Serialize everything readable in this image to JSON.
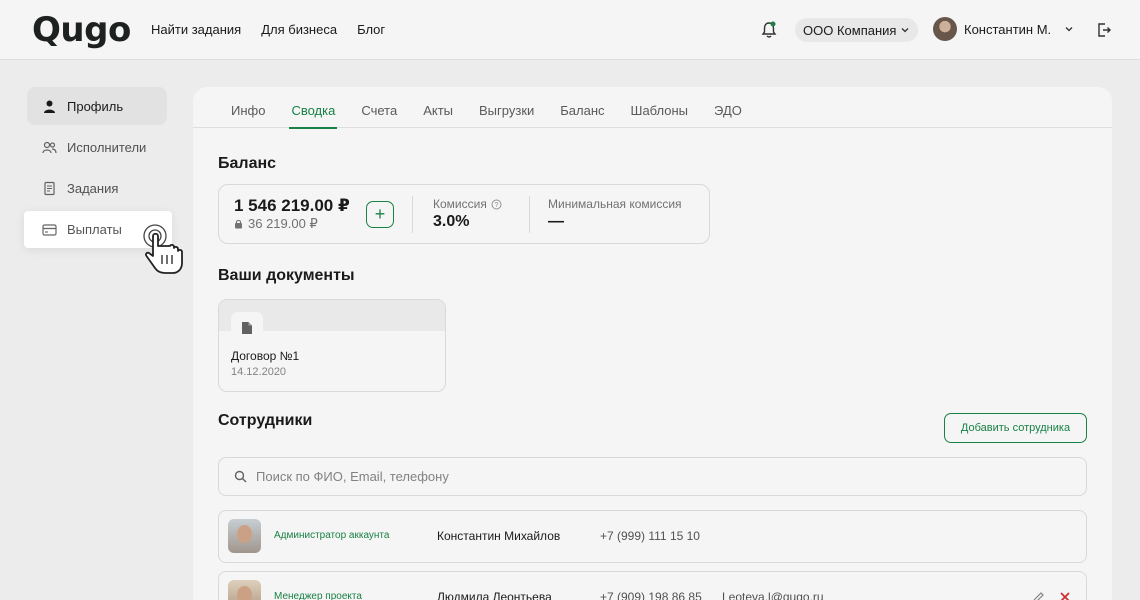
{
  "header": {
    "logo": "Qugo",
    "nav": [
      "Найти задания",
      "Для бизнеса",
      "Блог"
    ],
    "company": "ООО Компания",
    "user": "Константин М."
  },
  "sidebar": {
    "items": [
      {
        "label": "Профиль",
        "icon": "person-icon",
        "active": true
      },
      {
        "label": "Исполнители",
        "icon": "users-icon"
      },
      {
        "label": "Задания",
        "icon": "document-icon"
      },
      {
        "label": "Выплаты",
        "icon": "card-icon",
        "highlighted": true
      }
    ]
  },
  "tabs": [
    "Инфо",
    "Сводка",
    "Счета",
    "Акты",
    "Выгрузки",
    "Баланс",
    "Шаблоны",
    "ЭДО"
  ],
  "active_tab": "Сводка",
  "balance": {
    "title": "Баланс",
    "amount": "1 546 219.00 ₽",
    "blocked": "36 219.00 ₽",
    "commission_label": "Комиссия",
    "commission_value": "3.0%",
    "min_commission_label": "Минимальная комиссия",
    "min_commission_value": "—"
  },
  "documents": {
    "title": "Ваши документы",
    "items": [
      {
        "name": "Договор №1",
        "date": "14.12.2020"
      }
    ]
  },
  "employees": {
    "title": "Сотрудники",
    "add_button": "Добавить сотрудника",
    "search_placeholder": "Поиск по ФИО, Email, телефону",
    "rows": [
      {
        "role": "Администратор аккаунта",
        "name": "Константин Михайлов",
        "phone": "+7 (999) 111 15 10",
        "email": ""
      },
      {
        "role": "Менеджер проекта",
        "name": "Людмила Леонтьева",
        "phone": "+7 (909) 198 86 85",
        "email": "Leoteva.l@qugo.ru"
      }
    ]
  },
  "colors": {
    "accent": "#1b8748",
    "danger": "#d63232"
  }
}
